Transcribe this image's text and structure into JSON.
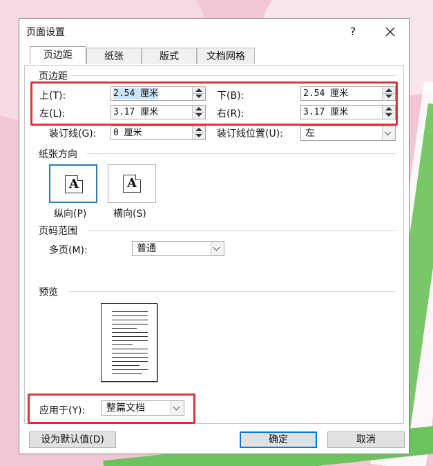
{
  "dialog": {
    "title": "页面设置",
    "help_label": "?",
    "tabs": [
      {
        "label": "页边距",
        "active": true
      },
      {
        "label": "纸张",
        "active": false
      },
      {
        "label": "版式",
        "active": false
      },
      {
        "label": "文档网格",
        "active": false
      }
    ]
  },
  "margins": {
    "group_label": "页边距",
    "top_label": "上(T):",
    "top_value": "2.54 厘米",
    "bottom_label": "下(B):",
    "bottom_value": "2.54 厘米",
    "left_label": "左(L):",
    "left_value": "3.17 厘米",
    "right_label": "右(R):",
    "right_value": "3.17 厘米",
    "gutter_label": "装订线(G):",
    "gutter_value": "0 厘米",
    "gutter_pos_label": "装订线位置(U):",
    "gutter_pos_value": "左"
  },
  "orientation": {
    "group_label": "纸张方向",
    "portrait_label": "纵向(P)",
    "landscape_label": "横向(S)",
    "icon_letter": "A",
    "selected": "portrait"
  },
  "pages": {
    "group_label": "页码范围",
    "multiple_label": "多页(M):",
    "multiple_value": "普通"
  },
  "preview": {
    "group_label": "预览",
    "apply_label": "应用于(Y):",
    "apply_value": "整篇文档"
  },
  "buttons": {
    "default_label": "设为默认值(D)",
    "ok_label": "确定",
    "cancel_label": "取消"
  },
  "colors": {
    "highlight_box": "#e0303a",
    "selection": "#cce4f7",
    "accent": "#0078d7"
  }
}
